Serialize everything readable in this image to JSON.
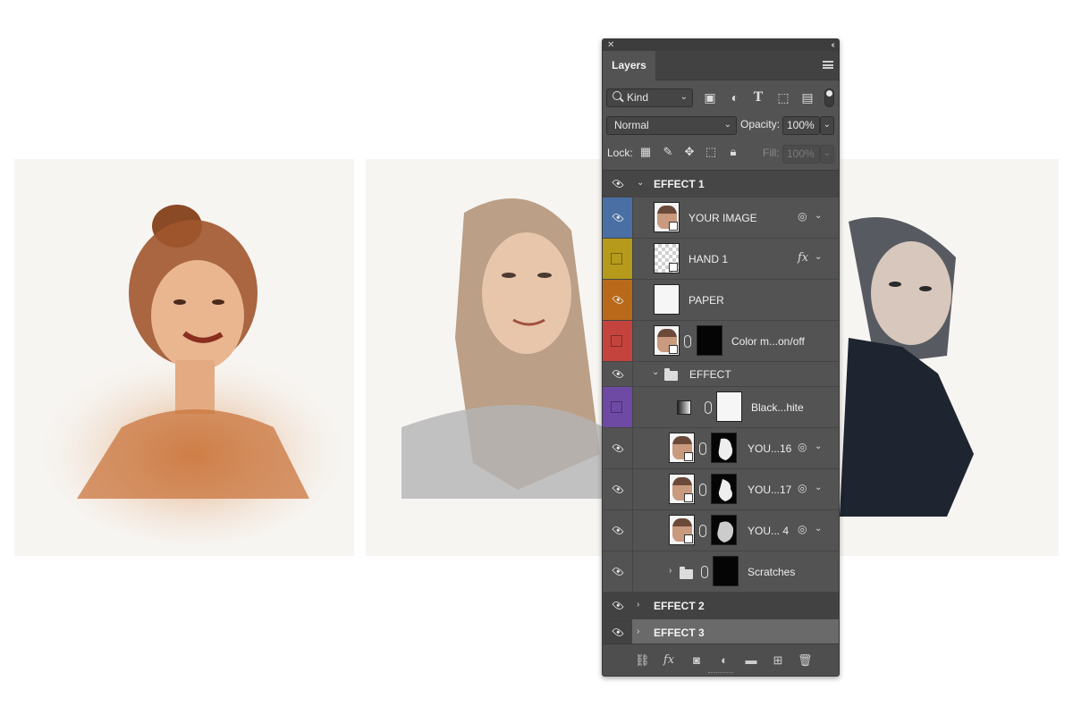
{
  "panel": {
    "tab_label": "Layers",
    "filter_kind": "Kind",
    "blend_mode": "Normal",
    "opacity_label": "Opacity:",
    "opacity_value": "100%",
    "lock_label": "Lock:",
    "fill_label": "Fill:",
    "fill_value": "100%"
  },
  "layers": [
    {
      "name": "EFFECT 1",
      "type": "group",
      "expanded": true
    },
    {
      "name": "YOUR IMAGE",
      "type": "smart-object",
      "color": "#4a6fa5"
    },
    {
      "name": "HAND 1",
      "type": "layer",
      "color": "#b59a1c"
    },
    {
      "name": "PAPER",
      "type": "layer",
      "color": "#b8691a"
    },
    {
      "name": "Color m...on/off",
      "type": "masked",
      "color": "#c4443d"
    },
    {
      "name": "EFFECT",
      "type": "group",
      "expanded": true
    },
    {
      "name": "Black...hite",
      "type": "adjustment",
      "color": "#6e4aa5"
    },
    {
      "name": "YOU...16",
      "type": "smart-object-masked"
    },
    {
      "name": "YOU...17",
      "type": "smart-object-masked"
    },
    {
      "name": "YOU... 4",
      "type": "smart-object-masked"
    },
    {
      "name": "Scratches",
      "type": "group-masked",
      "expanded": false
    },
    {
      "name": "EFFECT 2",
      "type": "group",
      "expanded": false
    },
    {
      "name": "EFFECT 3",
      "type": "group",
      "expanded": false,
      "selected": true
    }
  ],
  "icons": {
    "filter": [
      "image-filter-icon",
      "adjustment-filter-icon",
      "type-filter-icon",
      "shape-filter-icon",
      "smart-object-filter-icon"
    ],
    "lock": [
      "lock-transparent-icon",
      "lock-paint-icon",
      "lock-position-icon",
      "lock-artboard-icon",
      "lock-all-icon"
    ],
    "bottom": [
      "link-layers-icon",
      "fx-icon",
      "add-mask-icon",
      "adjustment-layer-icon",
      "new-group-icon",
      "new-layer-icon",
      "delete-icon"
    ]
  }
}
